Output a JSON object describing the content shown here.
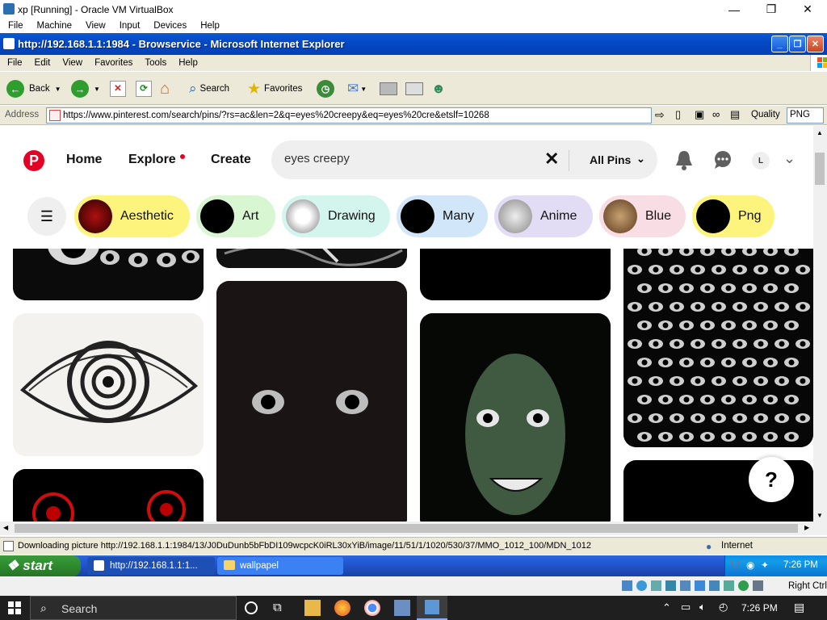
{
  "vbox": {
    "title": "xp [Running] - Oracle VM VirtualBox",
    "menu": [
      "File",
      "Machine",
      "View",
      "Input",
      "Devices",
      "Help"
    ],
    "host_ctrl": "Right Ctrl"
  },
  "ie": {
    "title": "http://192.168.1.1:1984 - Browservice - Microsoft Internet Explorer",
    "menu": [
      "File",
      "Edit",
      "View",
      "Favorites",
      "Tools",
      "Help"
    ],
    "toolbar": {
      "back": "Back",
      "search": "Search",
      "favorites": "Favorites"
    },
    "address_label": "Address",
    "address_value": "https://www.pinterest.com/search/pins/?rs=ac&len=2&q=eyes%20creepy&eq=eyes%20cre&etslf=10268",
    "quality_label": "Quality",
    "quality_value": "PNG",
    "status_text": "Downloading picture http://192.168.1.1:1984/13/J0DuDunb5bFbDI109wcpcK0iRL30xYiB/image/11/51/1/1020/530/37/MMO_1012_100/MDN_1012",
    "status_zone": "Internet"
  },
  "pinterest": {
    "nav": {
      "home": "Home",
      "explore": "Explore",
      "create": "Create"
    },
    "search_value": "eyes creepy",
    "filter_label": "All Pins",
    "avatar_letter": "L",
    "chips": [
      {
        "label": "Aesthetic",
        "color": "#fcf47c"
      },
      {
        "label": "Art",
        "color": "#d8f6d2"
      },
      {
        "label": "Drawing",
        "color": "#d3f5ee"
      },
      {
        "label": "Many",
        "color": "#d2e6f9"
      },
      {
        "label": "Anime",
        "color": "#e3dcf5"
      },
      {
        "label": "Blue",
        "color": "#f9dde4"
      },
      {
        "label": "Png",
        "color": "#fcf47c"
      }
    ],
    "help": "?"
  },
  "xp_taskbar": {
    "start": "start",
    "tasks": [
      "http://192.168.1.1:1...",
      "wallpapel"
    ],
    "clock": "7:26 PM"
  },
  "win10": {
    "search": "Search",
    "clock": "7:26 PM"
  }
}
